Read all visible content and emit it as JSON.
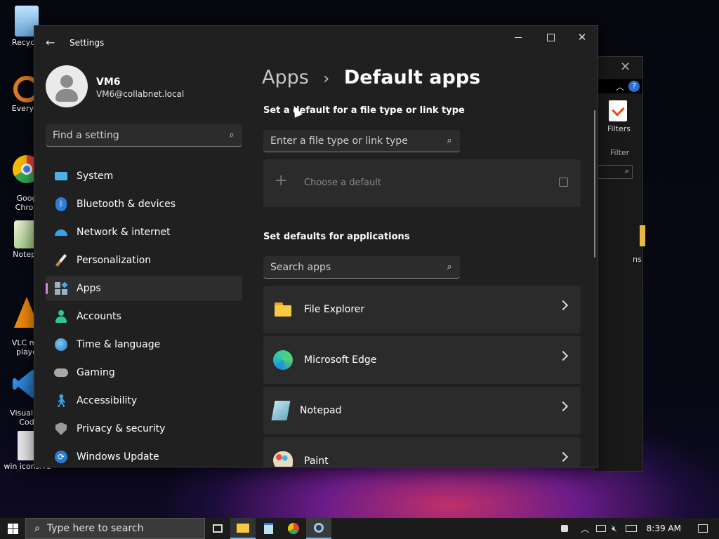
{
  "desktop": {
    "icons": [
      {
        "label": "Recycle",
        "color": "#7fb8e0"
      },
      {
        "label": "Everyth",
        "color": "#e07a1f"
      },
      {
        "label": "Goog\nChron",
        "color": "#3a8ee6"
      },
      {
        "label": "Notepa",
        "color": "#7ab35a"
      },
      {
        "label": "VLC me\nplaye",
        "color": "#f08a0c"
      },
      {
        "label": "Visual St\nCod",
        "color": "#2c80d0"
      },
      {
        "label": "win icons.7z",
        "color": "#dcdcdc"
      }
    ],
    "bg_window": {
      "filters_label": "Filters",
      "filter_label": "Filter",
      "partial_text": "ns"
    }
  },
  "settings": {
    "title": "Settings",
    "user": {
      "name": "VM6",
      "email": "VM6@collabnet.local"
    },
    "search_placeholder": "Find a setting",
    "nav": [
      {
        "label": "System",
        "icon": "monitor-icon",
        "selected": false
      },
      {
        "label": "Bluetooth & devices",
        "icon": "bluetooth-icon",
        "selected": false
      },
      {
        "label": "Network & internet",
        "icon": "wifi-icon",
        "selected": false
      },
      {
        "label": "Personalization",
        "icon": "paintbrush-icon",
        "selected": false
      },
      {
        "label": "Apps",
        "icon": "apps-icon",
        "selected": true
      },
      {
        "label": "Accounts",
        "icon": "person-icon",
        "selected": false
      },
      {
        "label": "Time & language",
        "icon": "globe-clock-icon",
        "selected": false
      },
      {
        "label": "Gaming",
        "icon": "gamepad-icon",
        "selected": false
      },
      {
        "label": "Accessibility",
        "icon": "accessibility-icon",
        "selected": false
      },
      {
        "label": "Privacy & security",
        "icon": "shield-icon",
        "selected": false
      },
      {
        "label": "Windows Update",
        "icon": "update-icon",
        "selected": false
      }
    ],
    "breadcrumb": {
      "parent": "Apps",
      "separator": "›",
      "current": "Default apps"
    },
    "file_type_section": {
      "heading": "Set a default for a file type or link type",
      "placeholder": "Enter a file type or link type",
      "choose_default": "Choose a default"
    },
    "apps_section": {
      "heading": "Set defaults for applications",
      "placeholder": "Search apps",
      "apps": [
        {
          "name": "File Explorer",
          "icon": "folder-icon"
        },
        {
          "name": "Microsoft Edge",
          "icon": "edge-icon"
        },
        {
          "name": "Notepad",
          "icon": "notepad-icon"
        },
        {
          "name": "Paint",
          "icon": "paint-icon"
        }
      ]
    }
  },
  "taskbar": {
    "search_placeholder": "Type here to search",
    "time": "8:39 AM"
  },
  "colors": {
    "accent": "#d28ae8",
    "window_bg": "#202020",
    "card_bg": "#2b2b2b"
  }
}
